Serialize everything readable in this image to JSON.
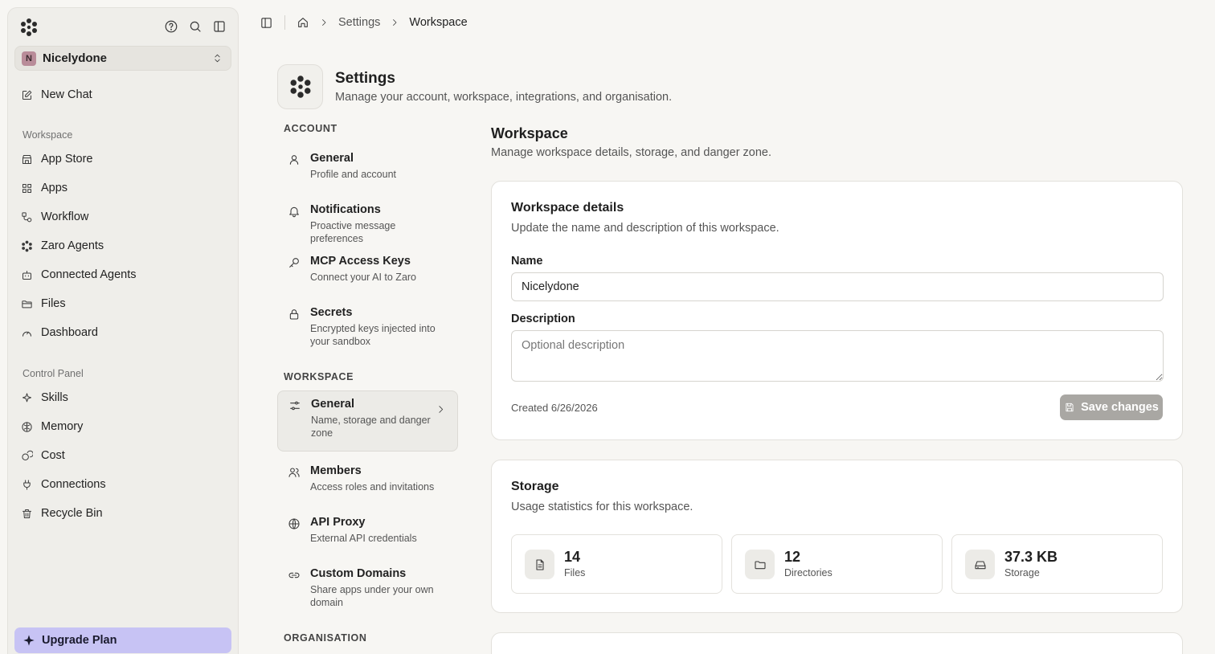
{
  "sidebar": {
    "workspace_badge": "N",
    "workspace_name": "Nicelydone",
    "new_chat": "New Chat",
    "section_workspace": "Workspace",
    "items_workspace": [
      {
        "label": "App Store",
        "icon": "store-icon"
      },
      {
        "label": "Apps",
        "icon": "grid-icon"
      },
      {
        "label": "Workflow",
        "icon": "workflow-icon"
      },
      {
        "label": "Zaro Agents",
        "icon": "agents-icon"
      },
      {
        "label": "Connected Agents",
        "icon": "robot-icon"
      },
      {
        "label": "Files",
        "icon": "folder-icon"
      },
      {
        "label": "Dashboard",
        "icon": "gauge-icon"
      }
    ],
    "section_control": "Control Panel",
    "items_control": [
      {
        "label": "Skills",
        "icon": "sparkle-icon"
      },
      {
        "label": "Memory",
        "icon": "brain-icon"
      },
      {
        "label": "Cost",
        "icon": "coins-icon"
      },
      {
        "label": "Connections",
        "icon": "plug-icon"
      },
      {
        "label": "Recycle Bin",
        "icon": "trash-icon"
      }
    ],
    "upgrade": "Upgrade Plan"
  },
  "breadcrumb": {
    "items": [
      "Settings",
      "Workspace"
    ]
  },
  "header": {
    "title": "Settings",
    "subtitle": "Manage your account, workspace, integrations, and organisation."
  },
  "menu": {
    "section_account": "ACCOUNT",
    "account": [
      {
        "title": "General",
        "desc": "Profile and account"
      },
      {
        "title": "Notifications",
        "desc": "Proactive message preferences"
      },
      {
        "title": "MCP Access Keys",
        "desc": "Connect your AI to Zaro"
      },
      {
        "title": "Secrets",
        "desc": "Encrypted keys injected into your sandbox"
      }
    ],
    "section_workspace": "WORKSPACE",
    "workspace": [
      {
        "title": "General",
        "desc": "Name, storage and danger zone"
      },
      {
        "title": "Members",
        "desc": "Access roles and invitations"
      },
      {
        "title": "API Proxy",
        "desc": "External API credentials"
      },
      {
        "title": "Custom Domains",
        "desc": "Share apps under your own domain"
      }
    ],
    "section_org": "ORGANISATION"
  },
  "main": {
    "title": "Workspace",
    "subtitle": "Manage workspace details, storage, and danger zone.",
    "details": {
      "title": "Workspace details",
      "subtitle": "Update the name and description of this workspace.",
      "name_label": "Name",
      "name_value": "Nicelydone",
      "desc_label": "Description",
      "desc_placeholder": "Optional description",
      "created": "Created 6/26/2026",
      "save": "Save changes"
    },
    "storage": {
      "title": "Storage",
      "subtitle": "Usage statistics for this workspace.",
      "stats": [
        {
          "value": "14",
          "label": "Files"
        },
        {
          "value": "12",
          "label": "Directories"
        },
        {
          "value": "37.3 KB",
          "label": "Storage"
        }
      ]
    }
  }
}
